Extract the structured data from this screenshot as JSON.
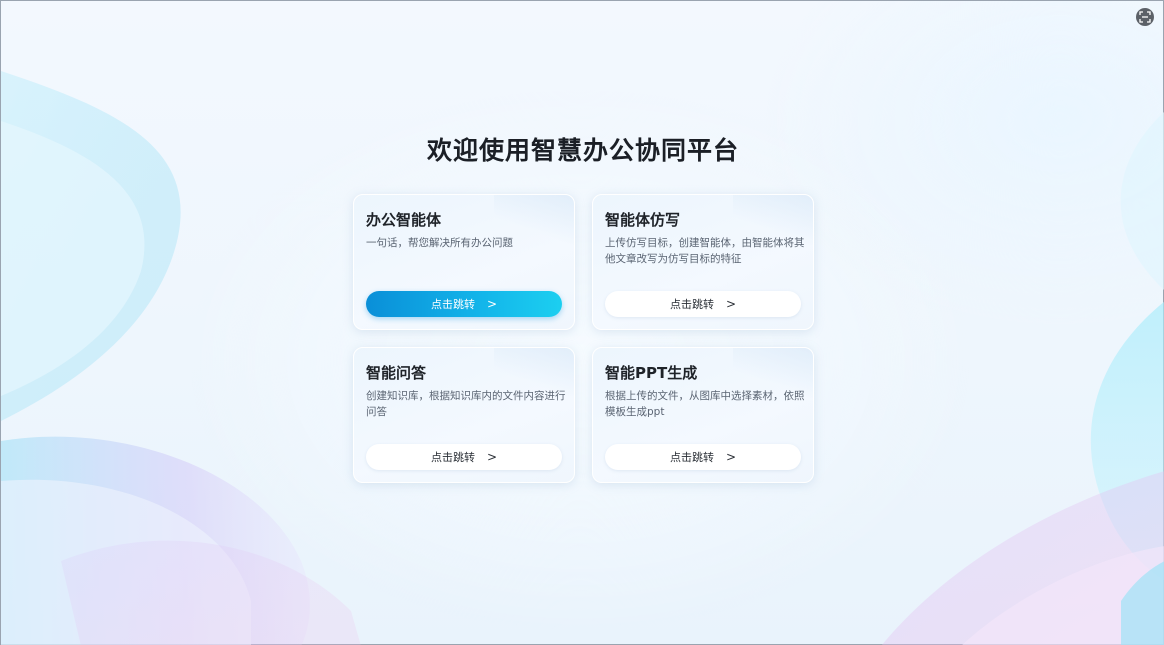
{
  "page": {
    "title": "欢迎使用智慧办公协同平台"
  },
  "corner": {
    "icon": "scan-icon"
  },
  "cards": [
    {
      "title": "办公智能体",
      "desc": "一句话，帮您解决所有办公问题",
      "button": "点击跳转",
      "chevron": ">",
      "primary": true
    },
    {
      "title": "智能体仿写",
      "desc": "上传仿写目标，创建智能体，由智能体将其他文章改写为仿写目标的特征",
      "button": "点击跳转",
      "chevron": ">",
      "primary": false
    },
    {
      "title": "智能问答",
      "desc": "创建知识库，根据知识库内的文件内容进行问答",
      "button": "点击跳转",
      "chevron": ">",
      "primary": false
    },
    {
      "title": "智能PPT生成",
      "desc": "根据上传的文件，从图库中选择素材，依照模板生成ppt",
      "button": "点击跳转",
      "chevron": ">",
      "primary": false
    }
  ],
  "colors": {
    "accent_start": "#0a8fd8",
    "accent_end": "#1ccff0",
    "title_text": "#1b1f26",
    "desc_text": "#5a6472"
  }
}
